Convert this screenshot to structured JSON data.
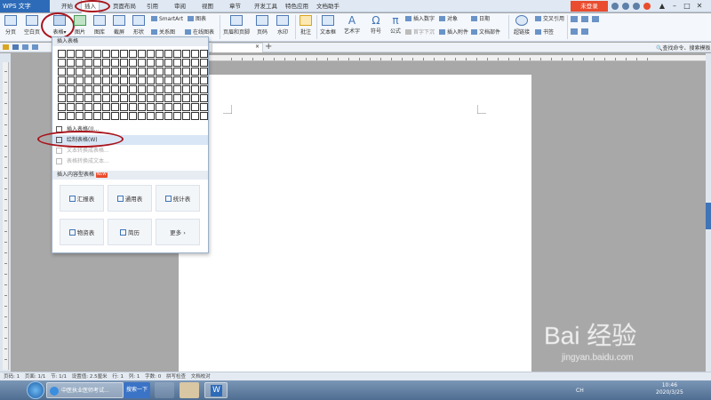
{
  "app": {
    "name": "WPS 文字",
    "login_label": "未登录"
  },
  "menu": {
    "items": [
      "开始",
      "插入",
      "页面布局",
      "引用",
      "审阅",
      "视图",
      "章节",
      "开发工具",
      "特色应用",
      "文档助手"
    ],
    "active": "插入"
  },
  "ribbon": {
    "page_break": "分页",
    "blank_page": "空白页",
    "table": "表格",
    "picture": "图片",
    "gallery": "图库",
    "screenshot": "截屏",
    "shapes": "形状",
    "smartart": "SmartArt",
    "chart": "图表",
    "relation": "关系图",
    "online_chart": "在线图表",
    "header_footer": "页眉和页脚",
    "page_number": "页码",
    "watermark": "水印",
    "comment": "批注",
    "textbox": "文本框",
    "wordart": "艺术字",
    "symbol": "符号",
    "formula": "公式",
    "insert_number": "插入数字",
    "object": "对象",
    "first_char": "首字下沉",
    "attachment": "插入附件",
    "date": "日期",
    "doc_parts": "文档部件",
    "hyperlink": "超链接",
    "cross_ref": "交叉引用",
    "bookmark": "书签"
  },
  "search_tip": "查找命令、搜索模板",
  "dropdown": {
    "header": "插入表格",
    "grid_cols": 17,
    "grid_rows": 8,
    "items": [
      {
        "label": "插入表格(I)...",
        "state": "normal"
      },
      {
        "label": "绘制表格(W)",
        "state": "highlighted"
      },
      {
        "label": "文本转换成表格...",
        "state": "disabled"
      },
      {
        "label": "表格转换成文本...",
        "state": "disabled"
      }
    ],
    "templates_header": "插入内容型表格",
    "new_badge": "NEW",
    "templates": [
      "汇报表",
      "通用表",
      "统计表",
      "物资表",
      "简历",
      "更多"
    ]
  },
  "statusbar": {
    "page_no": "页码: 1",
    "pages": "页面: 1/1",
    "section": "节: 1/1",
    "setting": "设置值: 2.5厘米",
    "row": "行: 1",
    "col": "列: 1",
    "words": "字数: 0",
    "spell": "拼写检查",
    "proof": "文档校对"
  },
  "taskbar": {
    "task1": "中医执业医师考试...",
    "task2": "搜索一下",
    "time": "10:46",
    "date": "2020/3/25",
    "lang": "CH"
  },
  "watermark": {
    "text": "Bai 经验",
    "url": "jingyan.baidu.com"
  }
}
